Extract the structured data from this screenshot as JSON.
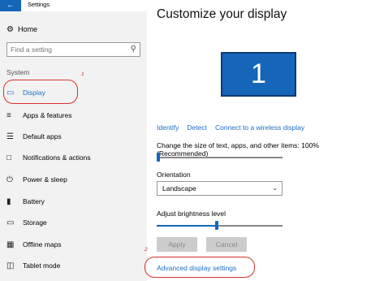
{
  "window": {
    "title": "Settings",
    "back_icon": "back-arrow-icon"
  },
  "sidebar": {
    "home_label": "Home",
    "search_placeholder": "Find a setting",
    "section": "System",
    "items": [
      {
        "label": "Display",
        "icon": "monitor-icon",
        "active": true
      },
      {
        "label": "Apps & features",
        "icon": "apps-list-icon"
      },
      {
        "label": "Default apps",
        "icon": "default-apps-icon"
      },
      {
        "label": "Notifications & actions",
        "icon": "notification-icon"
      },
      {
        "label": "Power & sleep",
        "icon": "power-icon"
      },
      {
        "label": "Battery",
        "icon": "battery-icon"
      },
      {
        "label": "Storage",
        "icon": "storage-icon"
      },
      {
        "label": "Offline maps",
        "icon": "map-icon"
      },
      {
        "label": "Tablet mode",
        "icon": "tablet-icon"
      }
    ]
  },
  "main": {
    "title": "Customize your display",
    "monitor_number": "1",
    "links": [
      "Identify",
      "Detect",
      "Connect to a wireless display"
    ],
    "text_size_label": "Change the size of text, apps, and other items: 100% (Recommended)",
    "text_size_slider_level": 0.0,
    "orientation_label": "Orientation",
    "orientation_value": "Landscape",
    "brightness_label": "Adjust brightness level",
    "brightness_level": 0.48,
    "apply_label": "Apply",
    "cancel_label": "Cancel",
    "advanced_link": "Advanced display settings"
  },
  "annotations": {
    "one": "1",
    "two": "2"
  },
  "colors": {
    "accent": "#1565b8",
    "link": "#1a6fc9",
    "annotation": "#d9302a",
    "sidebar_bg": "#f2f2f2"
  }
}
